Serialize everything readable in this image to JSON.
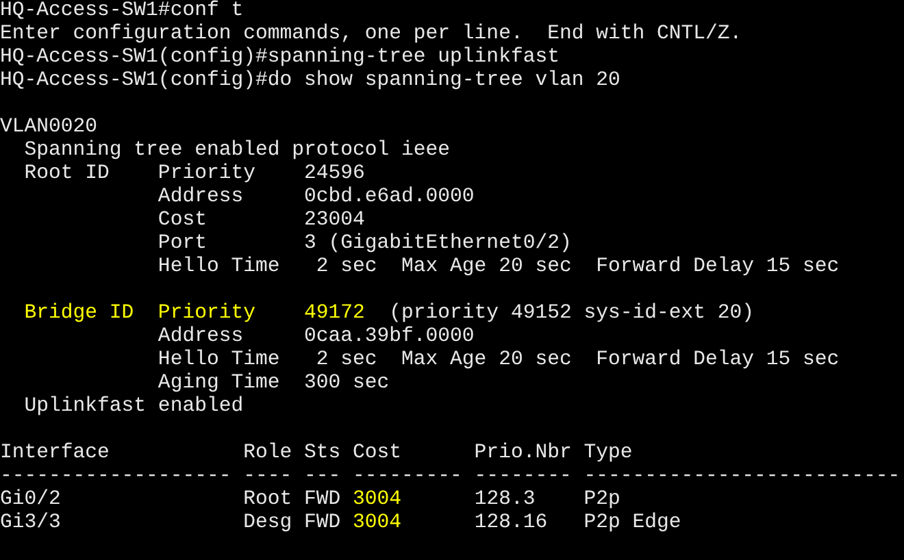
{
  "terminal": {
    "blocks": [
      {
        "lines": [
          {
            "segments": [
              {
                "text": "HQ-Access-SW1#conf t",
                "highlighted": false
              }
            ]
          },
          {
            "segments": [
              {
                "text": "Enter configuration commands, one per line.  End with CNTL/Z.",
                "highlighted": false
              }
            ]
          },
          {
            "segments": [
              {
                "text": "HQ-Access-SW1(config)#spanning-tree uplinkfast",
                "highlighted": false
              }
            ]
          },
          {
            "segments": [
              {
                "text": "HQ-Access-SW1(config)#do show spanning-tree vlan 20",
                "highlighted": false
              }
            ]
          }
        ]
      },
      {
        "lines": [
          {
            "segments": [
              {
                "text": "VLAN0020",
                "highlighted": false
              }
            ]
          },
          {
            "segments": [
              {
                "text": "  Spanning tree enabled protocol ieee",
                "highlighted": false
              }
            ]
          },
          {
            "segments": [
              {
                "text": "  Root ID    Priority    24596",
                "highlighted": false
              }
            ]
          },
          {
            "segments": [
              {
                "text": "             Address     0cbd.e6ad.0000",
                "highlighted": false
              }
            ]
          },
          {
            "segments": [
              {
                "text": "             Cost        23004",
                "highlighted": false
              }
            ]
          },
          {
            "segments": [
              {
                "text": "             Port        3 (GigabitEthernet0/2)",
                "highlighted": false
              }
            ]
          },
          {
            "segments": [
              {
                "text": "             Hello Time   2 sec  Max Age 20 sec  Forward Delay 15 sec",
                "highlighted": false
              }
            ]
          }
        ]
      },
      {
        "lines": [
          {
            "segments": [
              {
                "text": "  Bridge ID  Priority    49172",
                "highlighted": true
              },
              {
                "text": "  (priority 49152 sys-id-ext 20)",
                "highlighted": false
              }
            ]
          },
          {
            "segments": [
              {
                "text": "             Address     0caa.39bf.0000",
                "highlighted": false
              }
            ]
          },
          {
            "segments": [
              {
                "text": "             Hello Time   2 sec  Max Age 20 sec  Forward Delay 15 sec",
                "highlighted": false
              }
            ]
          },
          {
            "segments": [
              {
                "text": "             Aging Time  300 sec",
                "highlighted": false
              }
            ]
          },
          {
            "segments": [
              {
                "text": "  Uplinkfast enabled",
                "highlighted": false
              }
            ]
          }
        ]
      },
      {
        "lines": [
          {
            "segments": [
              {
                "text": "Interface           Role Sts Cost      Prio.Nbr Type",
                "highlighted": false
              }
            ]
          },
          {
            "segments": [
              {
                "text": "------------------- ---- --- --------- -------- --------------------------",
                "highlighted": false
              }
            ]
          },
          {
            "segments": [
              {
                "text": "Gi0/2               Root FWD ",
                "highlighted": false
              },
              {
                "text": "3004",
                "highlighted": true
              },
              {
                "text": "      128.3    P2p",
                "highlighted": false
              }
            ]
          },
          {
            "segments": [
              {
                "text": "Gi3/3               Desg FWD ",
                "highlighted": false
              },
              {
                "text": "3004",
                "highlighted": true
              },
              {
                "text": "      128.16   P2p Edge",
                "highlighted": false
              }
            ]
          }
        ]
      }
    ]
  }
}
